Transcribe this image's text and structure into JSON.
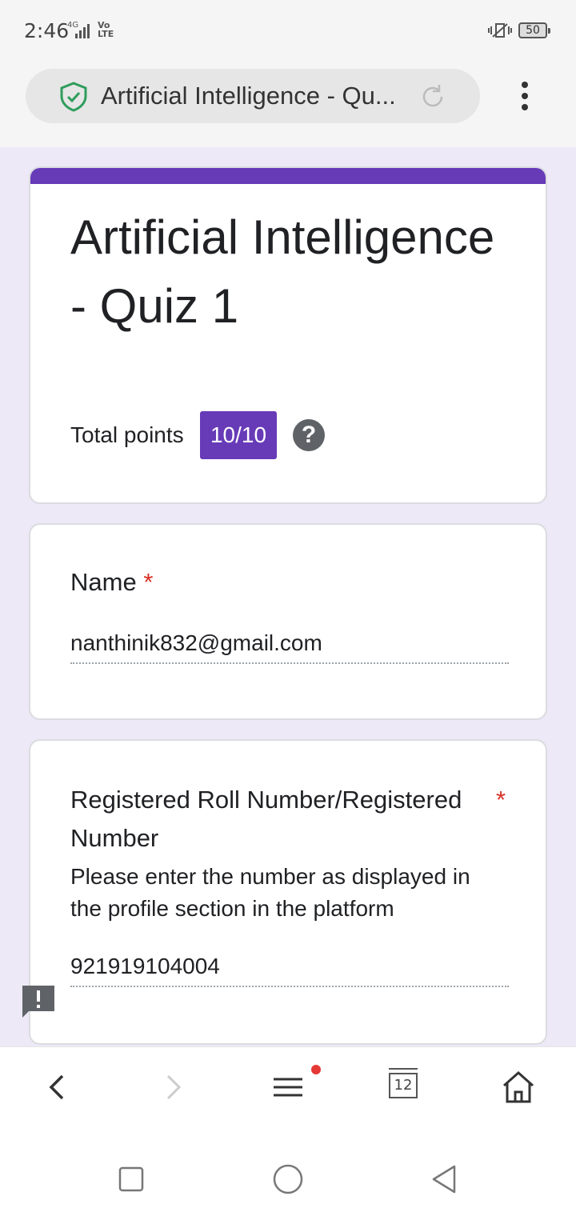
{
  "status_bar": {
    "time": "2:46",
    "network": "4G",
    "volte": "Vo LTE",
    "battery": "50"
  },
  "browser": {
    "page_title": "Artificial Intelligence - Qu...",
    "icons": [
      "shield-check-icon",
      "reload-icon",
      "more-vert-icon"
    ]
  },
  "form": {
    "title": "Artificial Intelligence - Quiz 1",
    "total_points_label": "Total points",
    "total_points_value": "10/10",
    "help_symbol": "?",
    "accent_color": "#673ab7",
    "questions": [
      {
        "label": "Name",
        "required_mark": "*",
        "answer": "nanthinik832@gmail.com"
      },
      {
        "label": "Registered Roll Number/Registered Number",
        "required_mark": "*",
        "description": "Please enter the number as displayed in the profile section in the platform",
        "answer": "921919104004"
      }
    ]
  },
  "browser_nav": {
    "tab_count": "12",
    "icons": [
      "back-icon",
      "forward-icon",
      "menu-icon",
      "tabs-icon",
      "home-icon"
    ]
  },
  "system_nav": {
    "icons": [
      "recent-apps-icon",
      "home-circle-icon",
      "back-triangle-icon"
    ]
  }
}
